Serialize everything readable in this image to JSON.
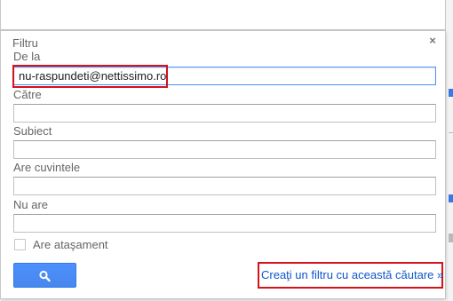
{
  "filter_dialog": {
    "title": "Filtru",
    "close_label": "×",
    "fields": {
      "from": {
        "label": "De la",
        "value": "nu-raspundeti@nettissimo.ro"
      },
      "to": {
        "label": "Către",
        "value": ""
      },
      "subject": {
        "label": "Subiect",
        "value": ""
      },
      "has_words": {
        "label": "Are cuvintele",
        "value": ""
      },
      "doesnt_have": {
        "label": "Nu are",
        "value": ""
      }
    },
    "has_attachment": {
      "label": "Are ataşament",
      "checked": false
    },
    "search_button_icon": "search-icon",
    "create_filter_link": "Creaţi un filtru cu această căutare »"
  },
  "colors": {
    "accent_blue": "#4d90fe",
    "link_blue": "#1155cc",
    "highlight_red": "#d5131a"
  }
}
